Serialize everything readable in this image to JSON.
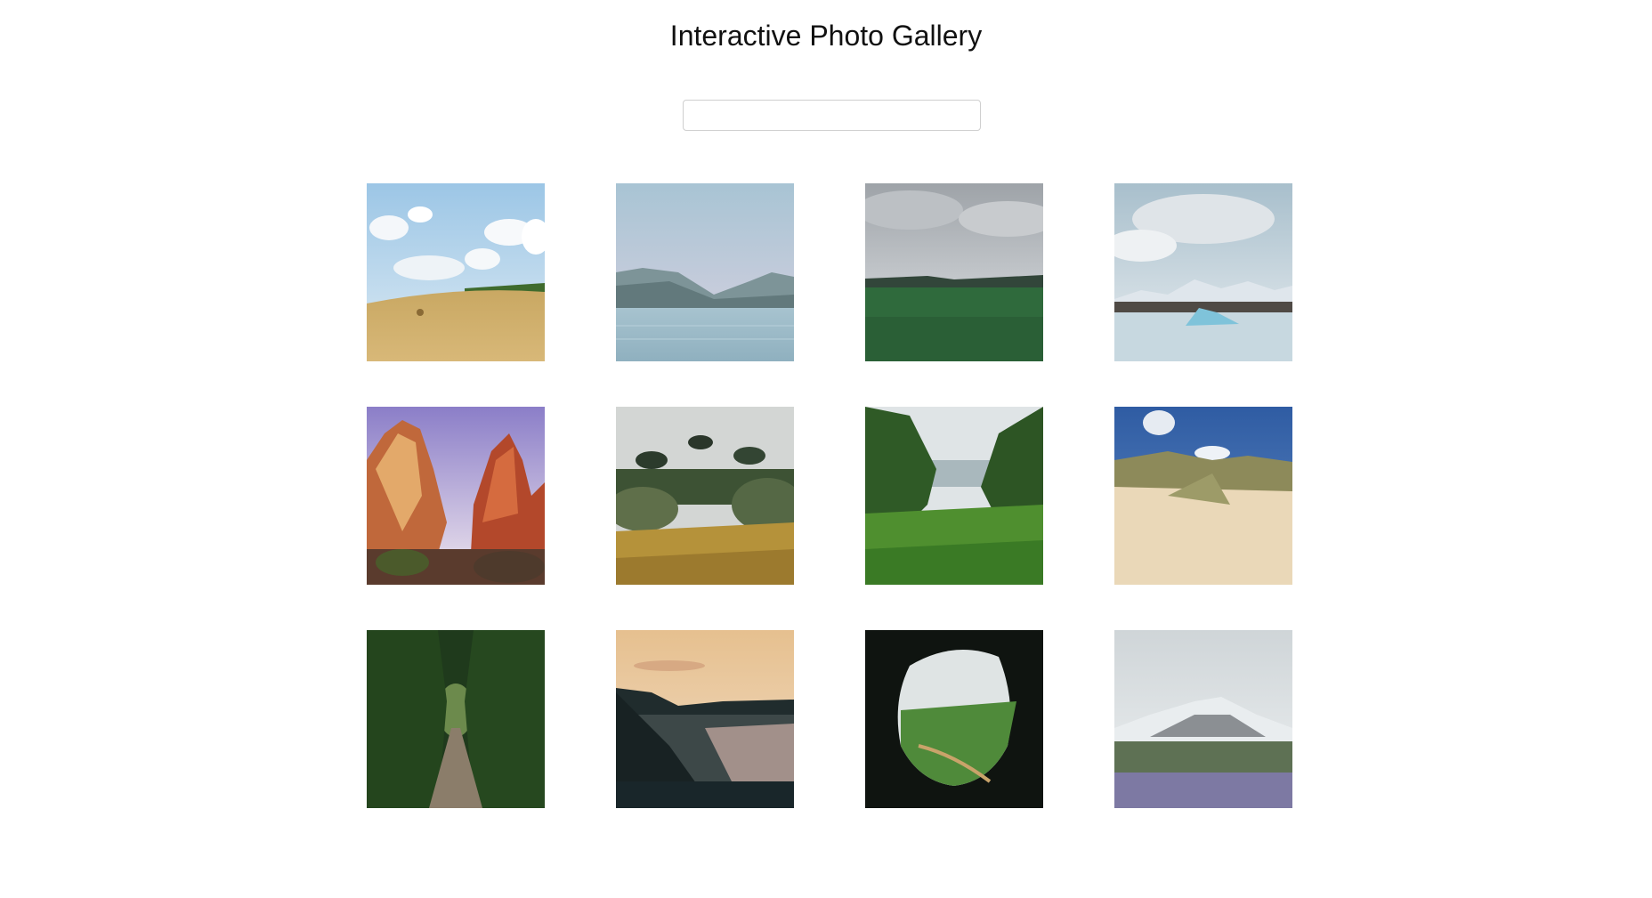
{
  "page": {
    "title": "Interactive Photo Gallery"
  },
  "search": {
    "value": "",
    "placeholder": ""
  },
  "gallery": {
    "photos": [
      {
        "scene": "hay-field-blue-sky"
      },
      {
        "scene": "misty-lake-mountains"
      },
      {
        "scene": "green-meadow-overcast"
      },
      {
        "scene": "glacier-lagoon-icebergs"
      },
      {
        "scene": "red-rock-canyon"
      },
      {
        "scene": "shrubland-trees"
      },
      {
        "scene": "jungle-valley-view"
      },
      {
        "scene": "sand-dunes-grass"
      },
      {
        "scene": "forest-path-tunnel"
      },
      {
        "scene": "coastal-cliffs-sunset"
      },
      {
        "scene": "cave-opening-valley"
      },
      {
        "scene": "snowy-mountain-lupine-field"
      }
    ]
  }
}
